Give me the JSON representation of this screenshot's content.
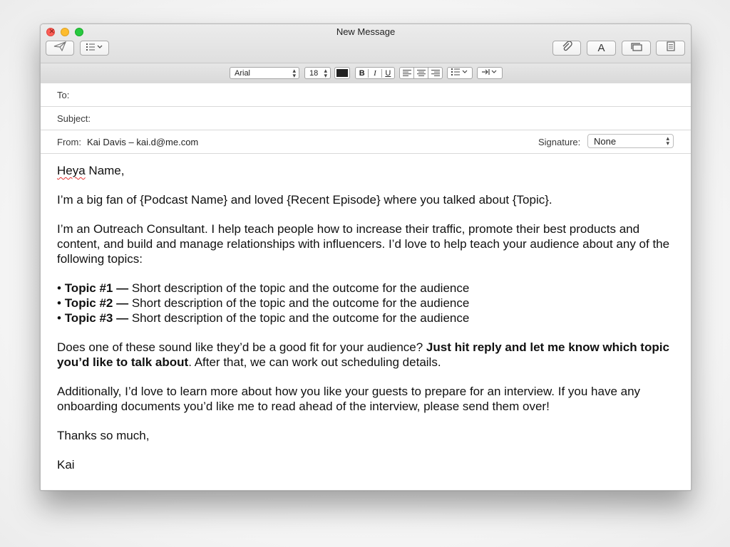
{
  "window": {
    "title": "New Message"
  },
  "toolbar": {
    "send": "send-icon",
    "header_fields": "list-icon",
    "attach": "paperclip-icon",
    "fonts": "A",
    "photo_browser": "window-icon",
    "stationery": "stationery-icon"
  },
  "format": {
    "font": "Arial",
    "size": "18",
    "bold": "B",
    "italic": "I",
    "underline": "U"
  },
  "fields": {
    "to_label": "To:",
    "to_value": "",
    "subject_label": "Subject:",
    "subject_value": "",
    "from_label": "From:",
    "from_value": "Kai Davis – kai.d@me.com",
    "signature_label": "Signature:",
    "signature_value": "None"
  },
  "message": {
    "greeting_name_word": "Heya",
    "greeting_rest": " Name,",
    "para1": "I’m a big fan of {Podcast Name} and loved {Recent Episode} where you talked about {Topic}.",
    "para2": "I’m an Outreach Consultant. I help teach people how to increase their traffic, promote their best products and content, and build and manage relationships with influencers. I’d love to help teach your audience about any of the following topics:",
    "bullets": [
      {
        "prefix": "• ",
        "title": "Topic #1",
        "sep": " — ",
        "desc": "Short description of the topic and the outcome for the audience"
      },
      {
        "prefix": "• ",
        "title": "Topic #2",
        "sep": " — ",
        "desc": "Short description of the topic and the outcome for the audience"
      },
      {
        "prefix": "• ",
        "title": "Topic #3",
        "sep": " — ",
        "desc": "Short description of the topic and the outcome for the audience"
      }
    ],
    "para3_start": "Does one of these sound like they’d be a good fit for your audience? ",
    "para3_bold": "Just hit reply and let me know which topic you’d like to talk about",
    "para3_end": ". After that, we can work out scheduling details.",
    "para4": "Additionally, I’d love to learn more about how you like your guests to prepare for an interview. If you have any onboarding documents you’d like me to read ahead of the interview, please send them over!",
    "closing": "Thanks so much,",
    "signature_name": "Kai"
  }
}
